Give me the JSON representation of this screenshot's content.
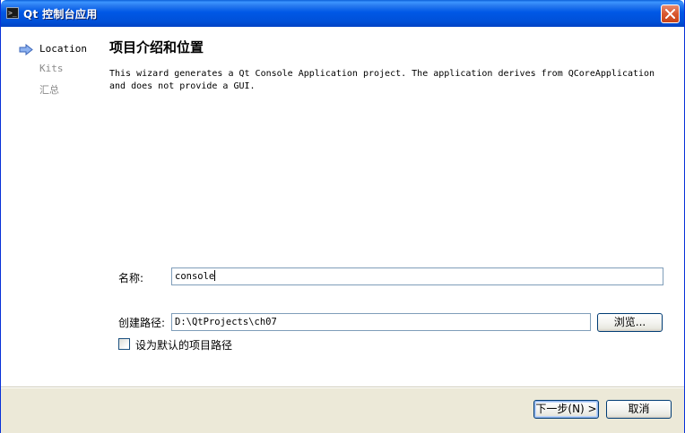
{
  "window": {
    "title": "Qt 控制台应用",
    "icon_glyph": ">_"
  },
  "steps": [
    {
      "label": "Location",
      "active": true
    },
    {
      "label": "Kits",
      "active": false
    },
    {
      "label": "汇总",
      "active": false
    }
  ],
  "page": {
    "title": "项目介绍和位置",
    "description": "This wizard generates a Qt Console Application project. The application derives from QCoreApplication and does not provide a GUI."
  },
  "form": {
    "name_label": "名称:",
    "name_value": "console",
    "path_label": "创建路径:",
    "path_value": "D:\\QtProjects\\ch07",
    "browse_label": "浏览...",
    "default_path_label": "设为默认的项目路径",
    "default_path_checked": false
  },
  "footer": {
    "next_label": "下一步(N) >",
    "cancel_label": "取消"
  },
  "colors": {
    "titlebar": "#0058e6",
    "step_arrow": "#4a7fd8",
    "footer_bg": "#ece9d8"
  }
}
